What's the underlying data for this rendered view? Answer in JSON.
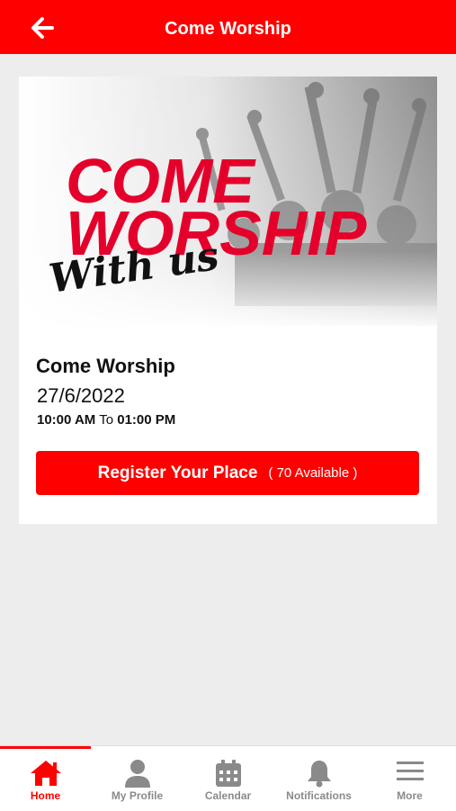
{
  "header": {
    "title": "Come Worship"
  },
  "banner": {
    "line1": "COME",
    "line2": "WORSHIP",
    "line3": "With us"
  },
  "event": {
    "title": "Come Worship",
    "date": "27/6/2022",
    "start_time": "10:00 AM",
    "time_separator": "To",
    "end_time": "01:00 PM",
    "register_label": "Register Your Place",
    "availability": "( 70 Available )"
  },
  "nav": {
    "items": [
      {
        "label": "Home",
        "icon": "home-icon",
        "active": true
      },
      {
        "label": "My Profile",
        "icon": "person-icon",
        "active": false
      },
      {
        "label": "Calendar",
        "icon": "calendar-icon",
        "active": false
      },
      {
        "label": "Notifications",
        "icon": "bell-icon",
        "active": false
      },
      {
        "label": "More",
        "icon": "menu-icon",
        "active": false
      }
    ]
  },
  "colors": {
    "accent": "#ff0000",
    "background": "#ecedec",
    "inactive": "#8a8a8a"
  }
}
